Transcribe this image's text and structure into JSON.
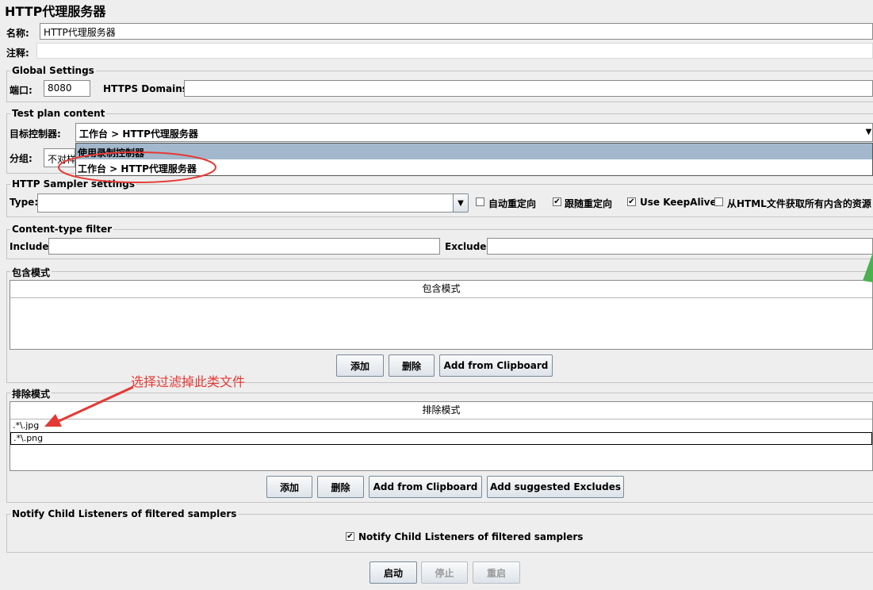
{
  "title": "HTTP代理服务器",
  "name_label": "名称:",
  "name_value": "HTTP代理服务器",
  "comment_label": "注释:",
  "global": {
    "legend": "Global Settings",
    "port_label": "端口:",
    "port_value": "8080",
    "https_label": "HTTPS Domains :",
    "https_value": ""
  },
  "test_plan": {
    "legend": "Test plan content",
    "target_label": "目标控制器:",
    "target_value": "工作台 > HTTP代理服务器",
    "group_label": "分组:",
    "group_value": "不对样",
    "dropdown_options": [
      "使用录制控制器",
      "工作台 > HTTP代理服务器"
    ]
  },
  "sampler": {
    "legend": "HTTP Sampler settings",
    "type_label": "Type:",
    "type_value": "",
    "checkboxes": [
      {
        "label": "自动重定向",
        "checked": false
      },
      {
        "label": "跟随重定向",
        "checked": true
      },
      {
        "label": "Use KeepAlive",
        "checked": true
      },
      {
        "label": "从HTML文件获取所有内含的资源",
        "checked": false
      }
    ]
  },
  "content_filter": {
    "legend": "Content-type filter",
    "include_label": "Include:",
    "include_value": "",
    "exclude_label": "Exclude:",
    "exclude_value": ""
  },
  "include_patterns": {
    "legend": "包含模式",
    "header": "包含模式",
    "rows": [],
    "buttons": {
      "add": "添加",
      "delete": "删除",
      "clipboard": "Add from Clipboard"
    }
  },
  "exclude_patterns": {
    "legend": "排除模式",
    "header": "排除模式",
    "rows": [
      ".*\\.jpg",
      ".*\\.png"
    ],
    "buttons": {
      "add": "添加",
      "delete": "删除",
      "clipboard": "Add from Clipboard",
      "suggested": "Add suggested Excludes"
    }
  },
  "annotation": {
    "text": "选择过滤掉此类文件",
    "color": "#e53935"
  },
  "notify": {
    "legend": "Notify Child Listeners of filtered samplers",
    "checkbox_label": "Notify Child Listeners of filtered samplers",
    "checked": true
  },
  "actions": {
    "start": "启动",
    "stop": "停止",
    "restart": "重启"
  }
}
